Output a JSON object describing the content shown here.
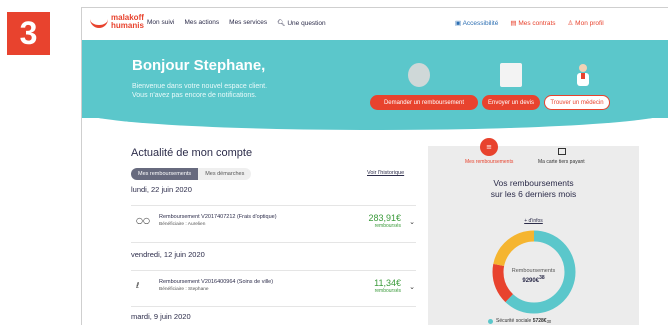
{
  "step_badge": "3",
  "logo": {
    "line1": "malakoff",
    "line2": "humanis"
  },
  "nav": {
    "items": [
      "Mon suivi",
      "Mes actions",
      "Mes services"
    ],
    "question": "Une question"
  },
  "right_nav": {
    "accessibility": "Accessibilité",
    "contracts": "Mes contrats",
    "profile": "Mon profil"
  },
  "hero": {
    "greeting": "Bonjour Stephane,",
    "line1": "Bienvenue dans votre nouvel espace client.",
    "line2": "Vous n'avez pas encore de notifications.",
    "buttons": [
      "Demander un remboursement",
      "Envoyer un devis",
      "Trouver un médecin"
    ]
  },
  "feed": {
    "title": "Actualité de mon compte",
    "tabs": [
      "Mes remboursements",
      "Mes démarches"
    ],
    "history_link": "Voir l'historique",
    "groups": [
      {
        "date": "lundi, 22 juin 2020",
        "entries": [
          {
            "icon": "glasses-icon",
            "label": "Remboursement V2017407212 (Frais d'optique)",
            "beneficiary": "Bénéficiaire : Aurelien",
            "amount": "283,91€",
            "status": "remboursés"
          }
        ]
      },
      {
        "date": "vendredi, 12 juin 2020",
        "entries": [
          {
            "icon": "stethoscope-icon",
            "label": "Remboursement V2016400964 (Soins de ville)",
            "beneficiary": "Bénéficiaire : Stephane",
            "amount": "11,34€",
            "status": "remboursés"
          }
        ]
      },
      {
        "date": "mardi, 9 juin 2020",
        "entries": []
      }
    ]
  },
  "panel": {
    "tabs": [
      "Mes remboursements",
      "Ma carte tiers payant"
    ],
    "title_line1": "Vos remboursements",
    "title_line2": "sur les 6 derniers mois",
    "info_link": "+ d'infos",
    "center_label": "Remboursements",
    "center_value": "9290€",
    "center_sup": "38",
    "legend": {
      "label": "Sécurité sociale",
      "value": "5728€",
      "sup": "30"
    }
  },
  "chart_data": {
    "type": "pie",
    "categories": [
      "Sécurité sociale"
    ],
    "values": [
      5728.3
    ],
    "total": 9290.38,
    "colors": [
      "#5bc7cb",
      "#e8432e",
      "#f5b530"
    ],
    "visual_shares": [
      0.62,
      0.16,
      0.22
    ]
  },
  "colors": {
    "brand": "#e8432e",
    "teal": "#5bc7cb",
    "green": "#3a9a3a",
    "yellow": "#f5b530"
  }
}
